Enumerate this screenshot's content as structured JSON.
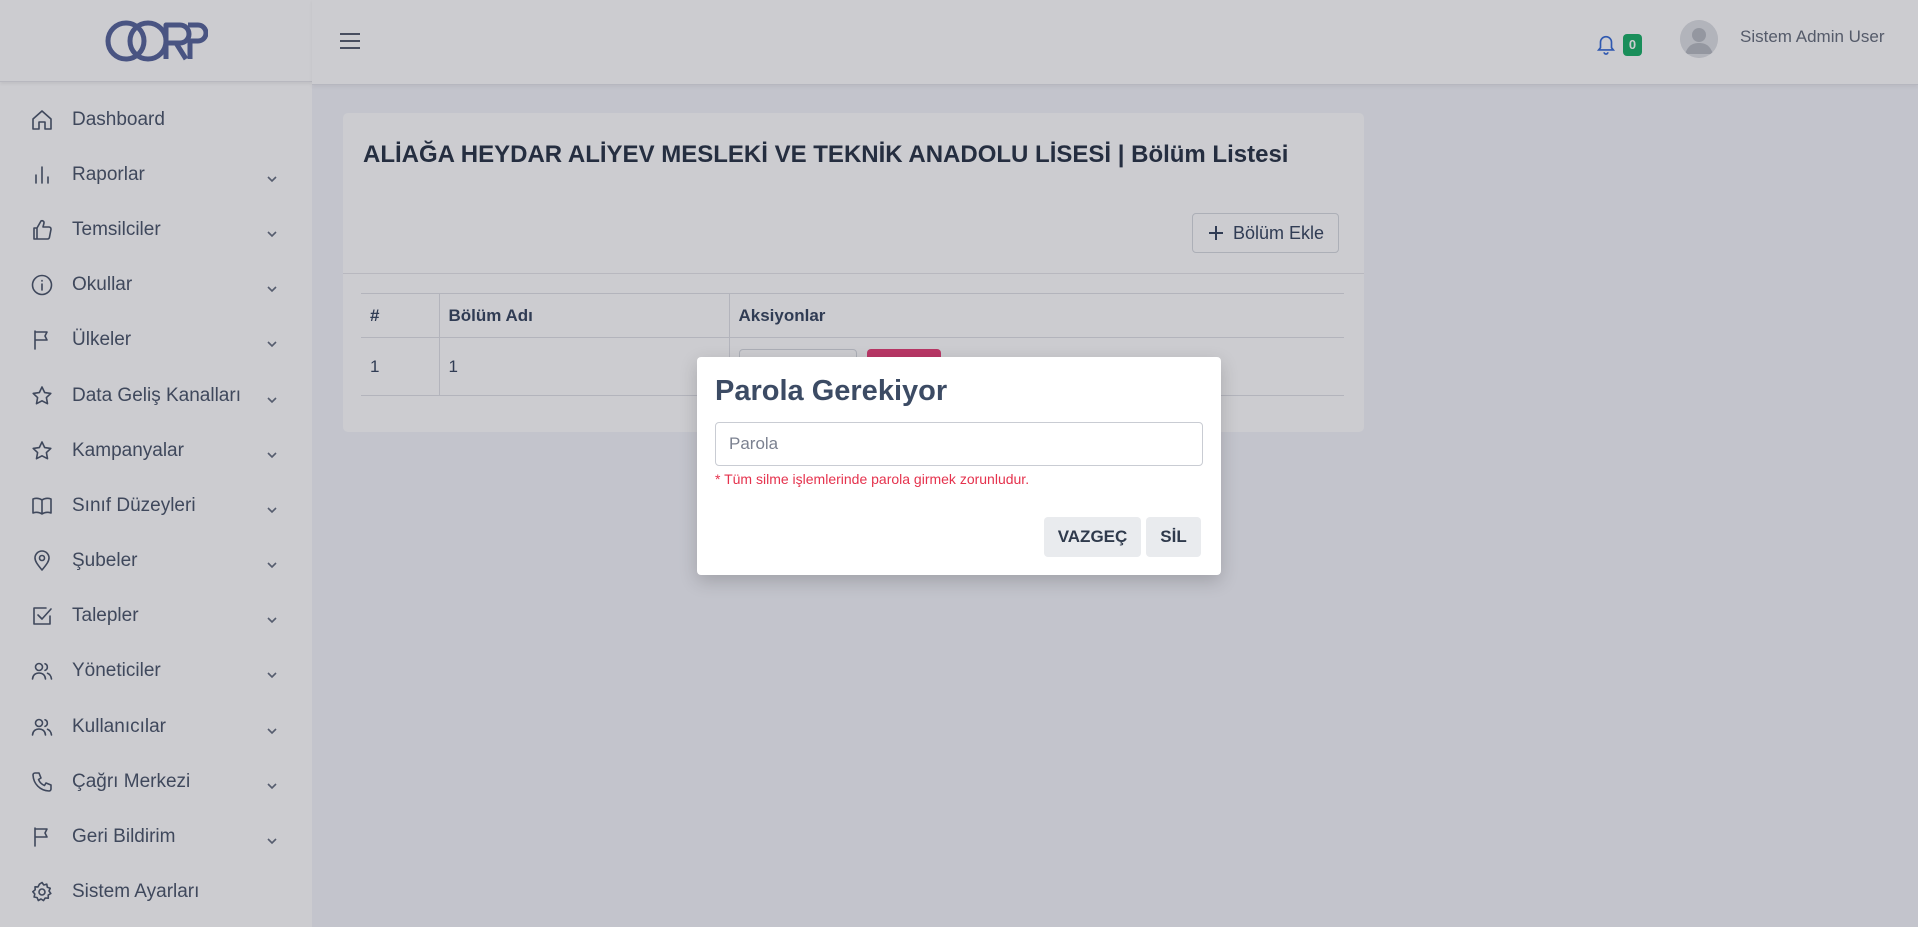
{
  "brand": {
    "logo_text": "CORP",
    "logo_color": "#5c6a9e"
  },
  "sidebar": {
    "items": [
      {
        "label": "Dashboard",
        "icon": "home-icon",
        "has_submenu": false
      },
      {
        "label": "Raporlar",
        "icon": "bar-chart-icon",
        "has_submenu": true
      },
      {
        "label": "Temsilciler",
        "icon": "thumbs-up-icon",
        "has_submenu": true
      },
      {
        "label": "Okullar",
        "icon": "info-icon",
        "has_submenu": true
      },
      {
        "label": "Ülkeler",
        "icon": "flag-icon",
        "has_submenu": true
      },
      {
        "label": "Data Geliş Kanalları",
        "icon": "star-icon",
        "has_submenu": true
      },
      {
        "label": "Kampanyalar",
        "icon": "star-icon",
        "has_submenu": true
      },
      {
        "label": "Sınıf Düzeyleri",
        "icon": "book-icon",
        "has_submenu": true
      },
      {
        "label": "Şubeler",
        "icon": "map-pin-icon",
        "has_submenu": true
      },
      {
        "label": "Talepler",
        "icon": "check-square-icon",
        "has_submenu": true
      },
      {
        "label": "Yöneticiler",
        "icon": "users-icon",
        "has_submenu": true
      },
      {
        "label": "Kullanıcılar",
        "icon": "users-icon",
        "has_submenu": true
      },
      {
        "label": "Çağrı Merkezi",
        "icon": "phone-icon",
        "has_submenu": true
      },
      {
        "label": "Geri Bildirim",
        "icon": "flag-icon",
        "has_submenu": true
      },
      {
        "label": "Sistem Ayarları",
        "icon": "gear-icon",
        "has_submenu": false
      }
    ]
  },
  "header": {
    "notification_count": "0",
    "user_name": "Sistem Admin User"
  },
  "page": {
    "title": "ALİAĞA HEYDAR ALİYEV MESLEKİ VE TEKNİK ANADOLU LİSESİ | Bölüm Listesi",
    "add_button_label": "Bölüm Ekle",
    "table": {
      "columns": [
        "#",
        "Bölüm Adı",
        "Aksiyonlar"
      ],
      "rows": [
        {
          "index": "1",
          "name": "1"
        }
      ]
    }
  },
  "modal": {
    "title": "Parola Gerekiyor",
    "password_placeholder": "Parola",
    "hint": "* Tüm silme işlemlerinde parola girmek zorunludur.",
    "cancel_label": "VAZGEÇ",
    "delete_label": "SİL"
  },
  "colors": {
    "accent": "#3b6fd8",
    "badge": "#20b26c",
    "danger": "#e8457b",
    "hint_red": "#e5324d"
  }
}
